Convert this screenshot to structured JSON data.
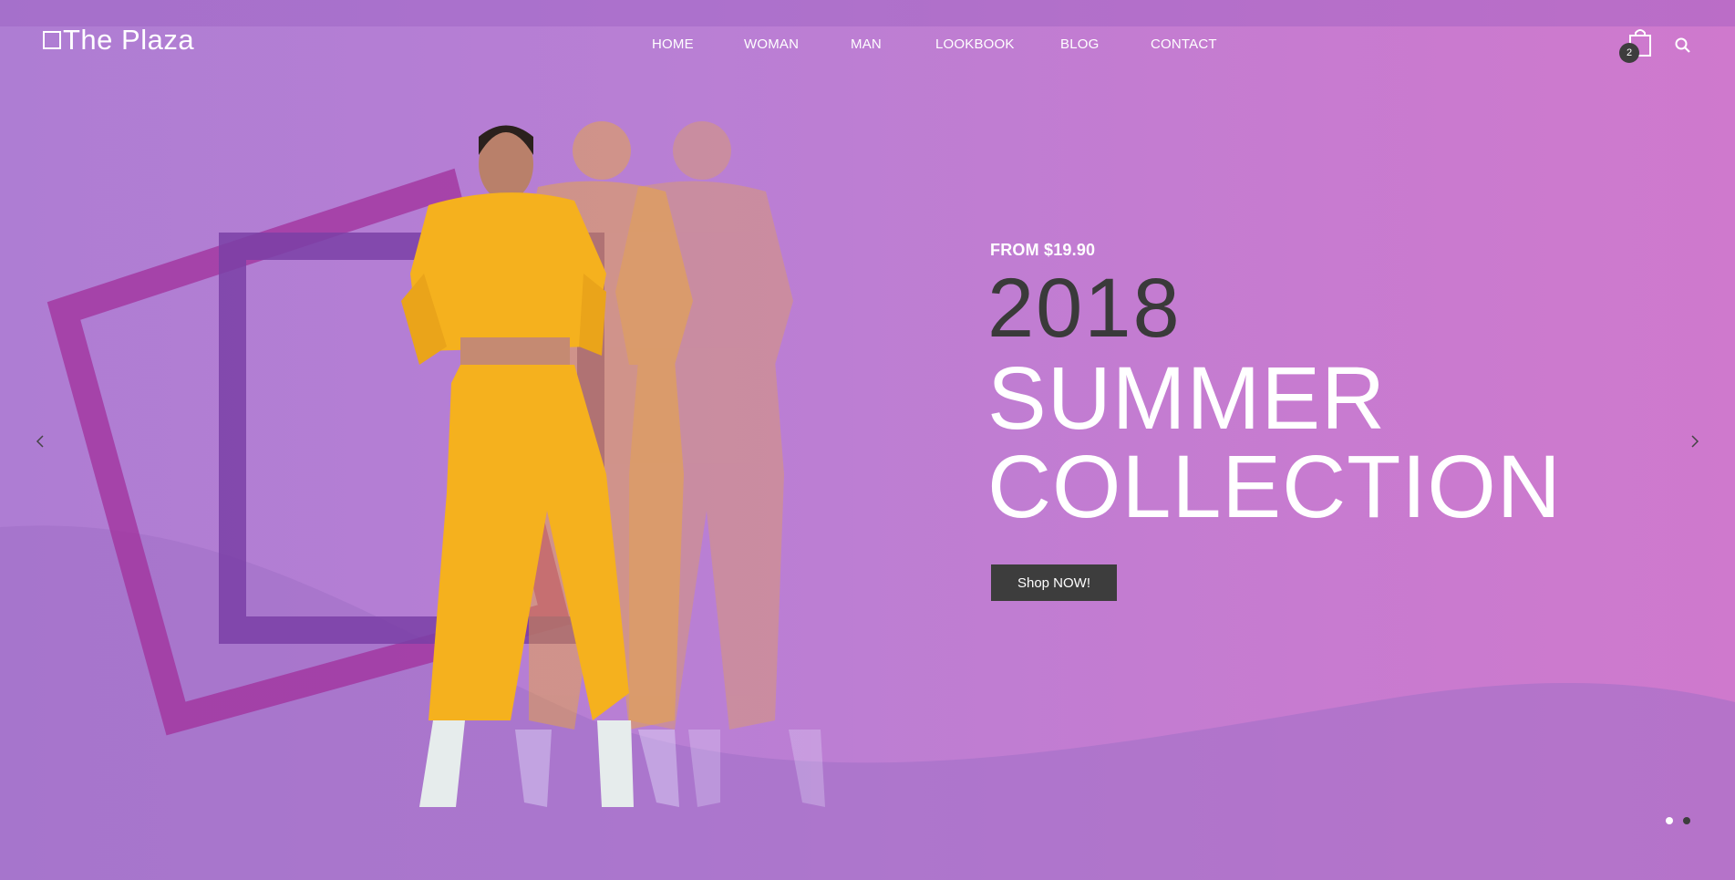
{
  "brand": {
    "name": "The Plaza"
  },
  "nav": {
    "items": [
      "HOME",
      "WOMAN",
      "MAN",
      "LOOKBOOK",
      "BLOG",
      "CONTACT"
    ]
  },
  "cart": {
    "count": "2"
  },
  "hero": {
    "price": "FROM $19.90",
    "year": "2018",
    "line1": "SUMMER",
    "line2": "COLLECTION",
    "cta": "Shop NOW!"
  },
  "slider": {
    "total": 2,
    "active": 2
  },
  "colors": {
    "dark": "#3d3d3d",
    "square_purple": "#7a3fa6",
    "square_magenta": "#a2309b",
    "outfit_yellow": "#f5b11e"
  },
  "icons": [
    "cart-icon",
    "search-icon",
    "arrow-left-icon",
    "arrow-right-icon"
  ]
}
